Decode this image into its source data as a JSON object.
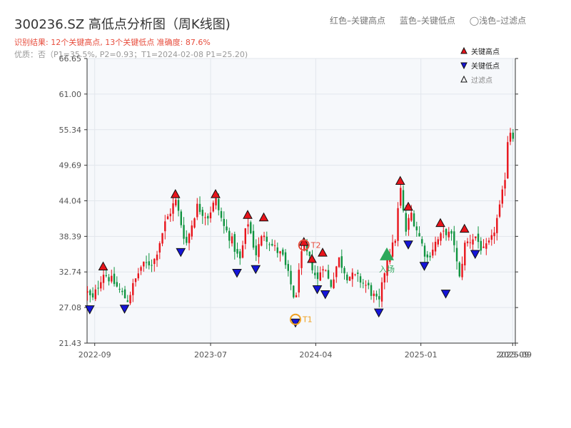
{
  "header": {
    "title": "300236.SZ 高低点分析图（周K线图)",
    "legend_high": "红色–关键高点",
    "legend_low": "蓝色–关键低点",
    "legend_filtered": "◯浅色–过滤点",
    "result_line": "识别结果: 12个关键高点, 13个关键低点   准确度: 87.6%",
    "quality_line": "优质：否（P1=35.5%, P2=0.93；T1=2024-02-08 P1=25.20)"
  },
  "legend": {
    "high": "关键高点",
    "low": "关键低点",
    "filtered": "过滤点"
  },
  "colors": {
    "up": "#e8141b",
    "down": "#109440",
    "high_marker": "#e8141b",
    "low_marker": "#1515d8",
    "entry": "#2ea85c",
    "t_marker": "#f0a020",
    "t2_label": "#e74c3c",
    "plot_bg": "#f6f8fb"
  },
  "chart_data": {
    "type": "candlestick",
    "title": "300236.SZ 高低点分析图（周K线图)",
    "ylim": [
      21.43,
      66.65
    ],
    "yticks": [
      "21.43",
      "27.08",
      "32.74",
      "38.39",
      "44.04",
      "49.69",
      "55.34",
      "61.00",
      "66.65"
    ],
    "xlim": [
      "2022-08-12",
      "2025-09-05"
    ],
    "xticks": [
      {
        "date": "2022-09-01",
        "label": "2022-09"
      },
      {
        "date": "2023-07-01",
        "label": "2023-07"
      },
      {
        "date": "2024-04-01",
        "label": "2024-04"
      },
      {
        "date": "2025-01-01",
        "label": "2025-01"
      },
      {
        "date": "2025-08-29",
        "label": "2025-09"
      },
      {
        "date": "2025-09-05",
        "label": "2025-09"
      }
    ],
    "grid": true,
    "legend_position": "top-right",
    "path": [
      [
        "2022-08-12",
        29.5
      ],
      [
        "2022-08-26",
        28.2
      ],
      [
        "2022-09-23",
        32.7
      ],
      [
        "2022-10-21",
        31.0
      ],
      [
        "2022-11-25",
        28.2
      ],
      [
        "2022-12-30",
        33.5
      ],
      [
        "2023-02-03",
        34.5
      ],
      [
        "2023-03-03",
        40.3
      ],
      [
        "2023-03-31",
        44.2
      ],
      [
        "2023-04-28",
        37.1
      ],
      [
        "2023-05-26",
        43.2
      ],
      [
        "2023-06-23",
        41.5
      ],
      [
        "2023-07-14",
        44.2
      ],
      [
        "2023-08-04",
        40.0
      ],
      [
        "2023-08-25",
        37.8
      ],
      [
        "2023-09-15",
        34.3
      ],
      [
        "2023-10-06",
        40.9
      ],
      [
        "2023-10-27",
        35.5
      ],
      [
        "2023-11-17",
        39.0
      ],
      [
        "2023-12-08",
        37.0
      ],
      [
        "2024-01-05",
        35.2
      ],
      [
        "2024-02-02",
        29.5
      ],
      [
        "2024-02-08",
        26.8
      ],
      [
        "2024-02-16",
        33.5
      ],
      [
        "2024-03-01",
        36.6
      ],
      [
        "2024-03-22",
        33.8
      ],
      [
        "2024-04-05",
        31.2
      ],
      [
        "2024-04-19",
        34.1
      ],
      [
        "2024-05-10",
        30.5
      ],
      [
        "2024-05-31",
        34.9
      ],
      [
        "2024-06-21",
        32.2
      ],
      [
        "2024-07-19",
        31.8
      ],
      [
        "2024-08-16",
        30.3
      ],
      [
        "2024-09-13",
        27.5
      ],
      [
        "2024-10-04",
        35.0
      ],
      [
        "2024-10-25",
        37.5
      ],
      [
        "2024-11-08",
        46.3
      ],
      [
        "2024-11-22",
        39.0
      ],
      [
        "2024-12-06",
        42.2
      ],
      [
        "2024-12-27",
        38.5
      ],
      [
        "2025-01-17",
        34.8
      ],
      [
        "2025-02-07",
        37.3
      ],
      [
        "2025-03-07",
        39.2
      ],
      [
        "2025-03-28",
        37.8
      ],
      [
        "2025-04-11",
        31.2
      ],
      [
        "2025-04-25",
        37.0
      ],
      [
        "2025-05-23",
        38.5
      ],
      [
        "2025-06-13",
        35.9
      ],
      [
        "2025-07-04",
        37.6
      ],
      [
        "2025-07-25",
        42.5
      ],
      [
        "2025-08-08",
        47.0
      ],
      [
        "2025-08-15",
        53.5
      ],
      [
        "2025-08-22",
        55.3
      ],
      [
        "2025-09-05",
        54.0
      ]
    ],
    "highs": [
      {
        "date": "2022-09-23",
        "price": 32.7
      },
      {
        "date": "2023-03-31",
        "price": 44.2
      },
      {
        "date": "2023-07-14",
        "price": 44.2
      },
      {
        "date": "2023-10-06",
        "price": 40.9
      },
      {
        "date": "2023-11-17",
        "price": 40.5
      },
      {
        "date": "2024-03-01",
        "price": 36.6
      },
      {
        "date": "2024-03-22",
        "price": 33.9
      },
      {
        "date": "2024-04-19",
        "price": 34.9
      },
      {
        "date": "2024-11-08",
        "price": 46.3
      },
      {
        "date": "2024-11-29",
        "price": 42.2
      },
      {
        "date": "2025-02-21",
        "price": 39.6
      },
      {
        "date": "2025-04-25",
        "price": 38.7
      }
    ],
    "lows": [
      {
        "date": "2022-08-19",
        "price": 27.7
      },
      {
        "date": "2022-11-18",
        "price": 27.8
      },
      {
        "date": "2023-04-14",
        "price": 36.8
      },
      {
        "date": "2023-09-08",
        "price": 33.5
      },
      {
        "date": "2023-10-27",
        "price": 34.1
      },
      {
        "date": "2024-02-08",
        "price": 25.6
      },
      {
        "date": "2024-04-05",
        "price": 30.9
      },
      {
        "date": "2024-04-26",
        "price": 30.1
      },
      {
        "date": "2024-09-13",
        "price": 27.2
      },
      {
        "date": "2024-11-29",
        "price": 38.0
      },
      {
        "date": "2025-01-10",
        "price": 34.6
      },
      {
        "date": "2025-03-07",
        "price": 30.2
      },
      {
        "date": "2025-05-23",
        "price": 36.5
      }
    ],
    "entry": {
      "date": "2024-10-04",
      "price": 35.5,
      "label": "入场"
    },
    "t_points": [
      {
        "label": "T1",
        "date": "2024-02-08",
        "price": 25.2
      },
      {
        "label": "T2",
        "date": "2024-03-01",
        "price": 37.0
      }
    ]
  }
}
